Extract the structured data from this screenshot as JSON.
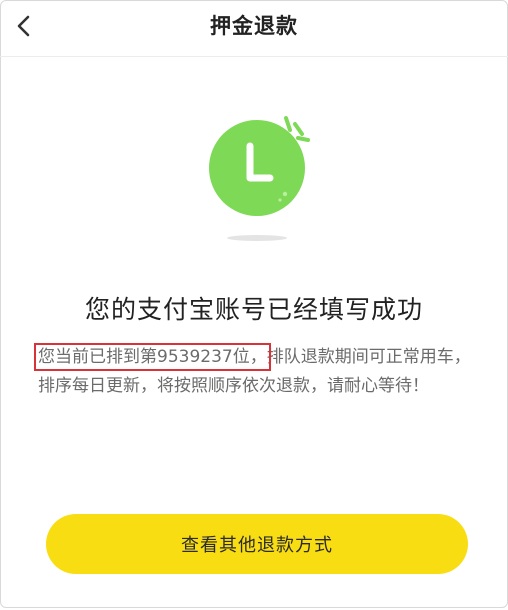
{
  "header": {
    "title": "押金退款",
    "back_icon": "chevron-left-icon"
  },
  "status": {
    "icon": "clock-icon",
    "icon_color": "#7ed957",
    "heading": "您的支付宝账号已经填写成功"
  },
  "queue": {
    "highlight_text": "您当前已排到第9539237位，",
    "rest_text": "排队退款期间可正常用车，排序每日更新，将按照顺序依次退款，请耐心等待！",
    "position_number": 9539237,
    "highlight_color": "#d9333a"
  },
  "action": {
    "button_label": "查看其他退款方式",
    "button_color": "#f9dd13"
  }
}
